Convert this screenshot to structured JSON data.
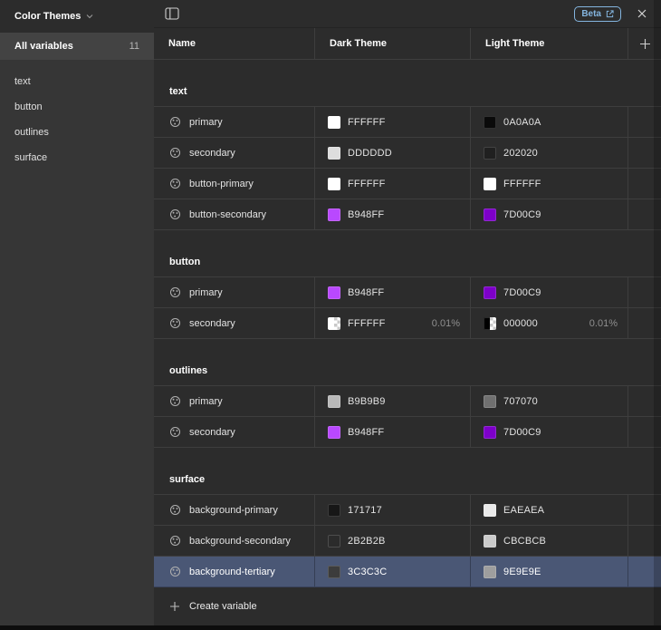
{
  "panel": {
    "topbar": {
      "beta_label": "Beta"
    },
    "sidebar": {
      "title": "Color Themes",
      "all_variables_label": "All variables",
      "all_variables_count": "11",
      "groups": [
        "text",
        "button",
        "outlines",
        "surface"
      ]
    },
    "table": {
      "columns": [
        "Name",
        "Dark Theme",
        "Light Theme"
      ],
      "sections": [
        {
          "label": "text",
          "rows": [
            {
              "name": "primary",
              "dark": {
                "hex": "FFFFFF"
              },
              "light": {
                "hex": "0A0A0A"
              }
            },
            {
              "name": "secondary",
              "dark": {
                "hex": "DDDDDD"
              },
              "light": {
                "hex": "202020"
              }
            },
            {
              "name": "button-primary",
              "dark": {
                "hex": "FFFFFF"
              },
              "light": {
                "hex": "FFFFFF"
              }
            },
            {
              "name": "button-secondary",
              "dark": {
                "hex": "B948FF"
              },
              "light": {
                "hex": "7D00C9"
              }
            }
          ]
        },
        {
          "label": "button",
          "rows": [
            {
              "name": "primary",
              "dark": {
                "hex": "B948FF"
              },
              "light": {
                "hex": "7D00C9"
              }
            },
            {
              "name": "secondary",
              "dark": {
                "hex": "FFFFFF",
                "alpha": "0.01%"
              },
              "light": {
                "hex": "000000",
                "alpha": "0.01%"
              }
            }
          ]
        },
        {
          "label": "outlines",
          "rows": [
            {
              "name": "primary",
              "dark": {
                "hex": "B9B9B9"
              },
              "light": {
                "hex": "707070"
              }
            },
            {
              "name": "secondary",
              "dark": {
                "hex": "B948FF"
              },
              "light": {
                "hex": "7D00C9"
              }
            }
          ]
        },
        {
          "label": "surface",
          "rows": [
            {
              "name": "background-primary",
              "dark": {
                "hex": "171717"
              },
              "light": {
                "hex": "EAEAEA"
              }
            },
            {
              "name": "background-secondary",
              "dark": {
                "hex": "2B2B2B"
              },
              "light": {
                "hex": "CBCBCB"
              }
            },
            {
              "name": "background-tertiary",
              "dark": {
                "hex": "3C3C3C"
              },
              "light": {
                "hex": "9E9E9E"
              },
              "selected": true
            }
          ]
        }
      ],
      "create_variable_label": "Create variable"
    },
    "colors": {
      "selected_row": "#4A5775",
      "beta_badge": "#84B5DF",
      "accent_purple": "#B948FF",
      "panel_background": "#2C2C2C",
      "sidebar_background": "#363636"
    }
  }
}
